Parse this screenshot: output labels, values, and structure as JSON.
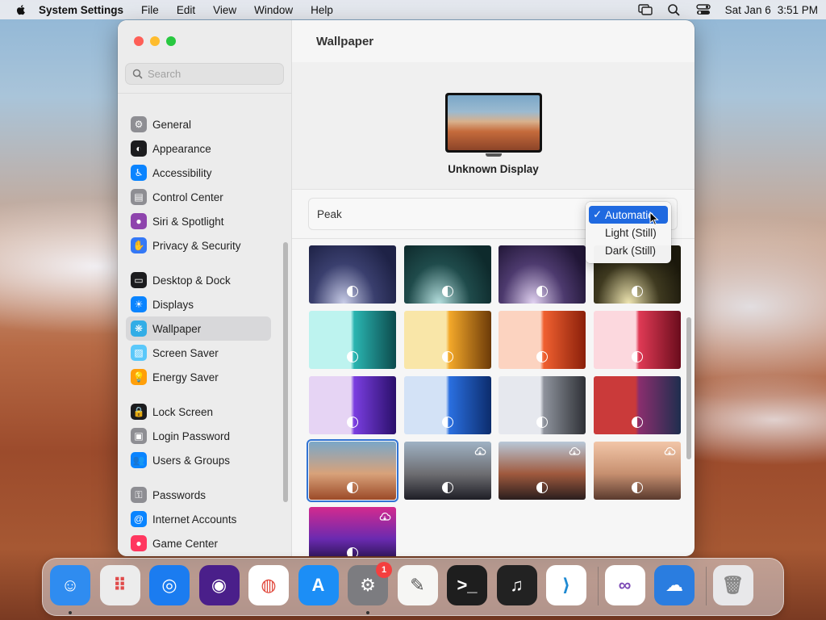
{
  "menubar": {
    "app_name": "System Settings",
    "menus": [
      "File",
      "Edit",
      "View",
      "Window",
      "Help"
    ],
    "date": "Sat Jan 6",
    "time": "3:51 PM"
  },
  "window": {
    "title": "Wallpaper",
    "search": {
      "placeholder": "Search",
      "value": ""
    }
  },
  "sidebar": {
    "groups": [
      [
        {
          "label": "General",
          "icon": "gear-icon",
          "color": "#8e8e93"
        },
        {
          "label": "Appearance",
          "icon": "appearance-icon",
          "color": "#1c1c1e"
        },
        {
          "label": "Accessibility",
          "icon": "accessibility-icon",
          "color": "#0a84ff"
        },
        {
          "label": "Control Center",
          "icon": "control-center-icon",
          "color": "#8e8e93"
        },
        {
          "label": "Siri & Spotlight",
          "icon": "siri-icon",
          "color": "#8e44ad"
        },
        {
          "label": "Privacy & Security",
          "icon": "hand-icon",
          "color": "#3478f6"
        }
      ],
      [
        {
          "label": "Desktop & Dock",
          "icon": "desktop-dock-icon",
          "color": "#1c1c1e"
        },
        {
          "label": "Displays",
          "icon": "displays-icon",
          "color": "#0a84ff"
        },
        {
          "label": "Wallpaper",
          "icon": "wallpaper-icon",
          "color": "#32ade6",
          "active": true
        },
        {
          "label": "Screen Saver",
          "icon": "screen-saver-icon",
          "color": "#5ac8fa"
        },
        {
          "label": "Energy Saver",
          "icon": "energy-saver-icon",
          "color": "#ff9f0a"
        }
      ],
      [
        {
          "label": "Lock Screen",
          "icon": "lock-icon",
          "color": "#1c1c1e"
        },
        {
          "label": "Login Password",
          "icon": "login-password-icon",
          "color": "#8e8e93"
        },
        {
          "label": "Users & Groups",
          "icon": "users-groups-icon",
          "color": "#0a84ff"
        }
      ],
      [
        {
          "label": "Passwords",
          "icon": "key-icon",
          "color": "#8e8e93"
        },
        {
          "label": "Internet Accounts",
          "icon": "at-icon",
          "color": "#0a84ff"
        },
        {
          "label": "Game Center",
          "icon": "game-center-icon",
          "color": "#ff375f"
        }
      ]
    ]
  },
  "display": {
    "name": "Unknown Display"
  },
  "style": {
    "current_wallpaper": "Peak"
  },
  "dropdown": {
    "options": [
      {
        "label": "Automatic",
        "selected": true
      },
      {
        "label": "Light (Still)",
        "selected": false
      },
      {
        "label": "Dark (Still)",
        "selected": false
      }
    ],
    "check_glyph": "✓"
  },
  "wallpapers": [
    {
      "colors": [
        "#3a3f6e",
        "#c9cde8",
        "#1e2246"
      ],
      "selected": false,
      "cloud": false,
      "mode_icon": true
    },
    {
      "colors": [
        "#1f4b4b",
        "#b6e0df",
        "#0e2a2c"
      ],
      "selected": false,
      "cloud": false,
      "mode_icon": true
    },
    {
      "colors": [
        "#4d3a6e",
        "#e2d3f2",
        "#221738"
      ],
      "selected": false,
      "cloud": false,
      "mode_icon": true
    },
    {
      "colors": [
        "#3f3a20",
        "#efe6b2",
        "#1c190c"
      ],
      "selected": false,
      "cloud": false,
      "mode_icon": true
    },
    {
      "colors": [
        "#bdf3ef",
        "#2ab5b1",
        "#0c4a4c"
      ],
      "selected": false,
      "cloud": false,
      "mode_icon": true
    },
    {
      "colors": [
        "#f9e6a8",
        "#f3a82a",
        "#6c3a08"
      ],
      "selected": false,
      "cloud": false,
      "mode_icon": true
    },
    {
      "colors": [
        "#fcd3c0",
        "#f06030",
        "#8a1f0a"
      ],
      "selected": false,
      "cloud": false,
      "mode_icon": true
    },
    {
      "colors": [
        "#fcd8de",
        "#e03a55",
        "#6a0c1c"
      ],
      "selected": false,
      "cloud": false,
      "mode_icon": true
    },
    {
      "colors": [
        "#e6d4f4",
        "#7a3ee0",
        "#2a0f6a"
      ],
      "selected": false,
      "cloud": false,
      "mode_icon": true
    },
    {
      "colors": [
        "#d3e2f6",
        "#2a6fe0",
        "#0c2c6c"
      ],
      "selected": false,
      "cloud": false,
      "mode_icon": true
    },
    {
      "colors": [
        "#e6e8ee",
        "#8e939c",
        "#2e3036"
      ],
      "selected": false,
      "cloud": false,
      "mode_icon": true
    },
    {
      "colors": [
        "#ca3a3a",
        "#8a2e6e",
        "#1e2e4e"
      ],
      "selected": false,
      "cloud": false,
      "mode_icon": true
    },
    {
      "colors": [
        "#7aa7c8",
        "#d8a27a",
        "#9c4a28"
      ],
      "selected": true,
      "cloud": false,
      "mode_icon": true
    },
    {
      "colors": [
        "#9fb2c4",
        "#6e6e72",
        "#1e1e26"
      ],
      "selected": false,
      "cloud": true,
      "mode_icon": true
    },
    {
      "colors": [
        "#b8c8d8",
        "#a05a3e",
        "#2a1e1e"
      ],
      "selected": false,
      "cloud": true,
      "mode_icon": true
    },
    {
      "colors": [
        "#f2c6a8",
        "#c79070",
        "#5a3a2e"
      ],
      "selected": false,
      "cloud": true,
      "mode_icon": true
    },
    {
      "colors": [
        "#d42a8e",
        "#6a2ab0",
        "#1a0e3a"
      ],
      "selected": false,
      "cloud": true,
      "mode_icon": true
    }
  ],
  "dock": {
    "apps": [
      {
        "name": "finder-icon",
        "color": "#2f8cf0",
        "running": true
      },
      {
        "name": "launchpad-icon",
        "color": "#ececec",
        "running": false
      },
      {
        "name": "safari-icon",
        "color": "#1b7cf0",
        "running": false
      },
      {
        "name": "firefox-icon",
        "color": "#4a1f8a",
        "running": false
      },
      {
        "name": "chrome-icon",
        "color": "#ffffff",
        "running": false
      },
      {
        "name": "app-store-icon",
        "color": "#1c8ef6",
        "running": false
      },
      {
        "name": "system-settings-icon",
        "color": "#7c7c80",
        "running": true,
        "badge": "1"
      },
      {
        "name": "textedit-icon",
        "color": "#f6f6f4",
        "running": false
      },
      {
        "name": "terminal-icon",
        "color": "#1e1e1e",
        "running": false
      },
      {
        "name": "garageband-icon",
        "color": "#222222",
        "running": false
      },
      {
        "name": "vscode-icon",
        "color": "#ffffff",
        "running": false
      },
      {
        "name": "visual-studio-icon",
        "color": "#ffffff",
        "running": false
      },
      {
        "name": "weather-icon",
        "color": "#2a7de0",
        "running": false
      },
      {
        "name": "trash-icon",
        "color": "#e8e8ea",
        "running": false
      }
    ]
  }
}
